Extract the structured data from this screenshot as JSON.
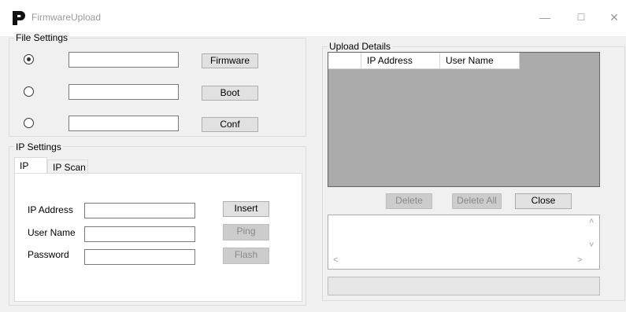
{
  "window": {
    "title": "FirmwareUpload",
    "logo_letter": "P",
    "controls": {
      "minimize": "—",
      "maximize": "☐",
      "close": "✕"
    }
  },
  "file_settings": {
    "label": "File Settings",
    "rows": [
      {
        "selected": true,
        "value": "",
        "button": "Firmware"
      },
      {
        "selected": false,
        "value": "",
        "button": "Boot"
      },
      {
        "selected": false,
        "value": "",
        "button": "Conf"
      }
    ]
  },
  "ip_settings": {
    "label": "IP Settings",
    "tabs": [
      "IP",
      "IP Scan"
    ],
    "active_tab": "IP",
    "fields": [
      {
        "label": "IP Address",
        "value": "",
        "button": "Insert",
        "button_enabled": true
      },
      {
        "label": "User Name",
        "value": "",
        "button": "Ping",
        "button_enabled": false
      },
      {
        "label": "Password",
        "value": "",
        "button": "Flash",
        "button_enabled": false
      }
    ]
  },
  "upload_details": {
    "label": "Upload Details",
    "columns": [
      "",
      "IP Address",
      "User Name"
    ],
    "rows": [],
    "buttons": [
      {
        "label": "Delete",
        "enabled": false
      },
      {
        "label": "Delete All",
        "enabled": false
      },
      {
        "label": "Close",
        "enabled": true
      }
    ],
    "log_text": "",
    "progress": 0
  },
  "icons": {
    "scroll_up": "˄",
    "scroll_down": "˅",
    "scroll_left": "<",
    "scroll_right": ">"
  }
}
